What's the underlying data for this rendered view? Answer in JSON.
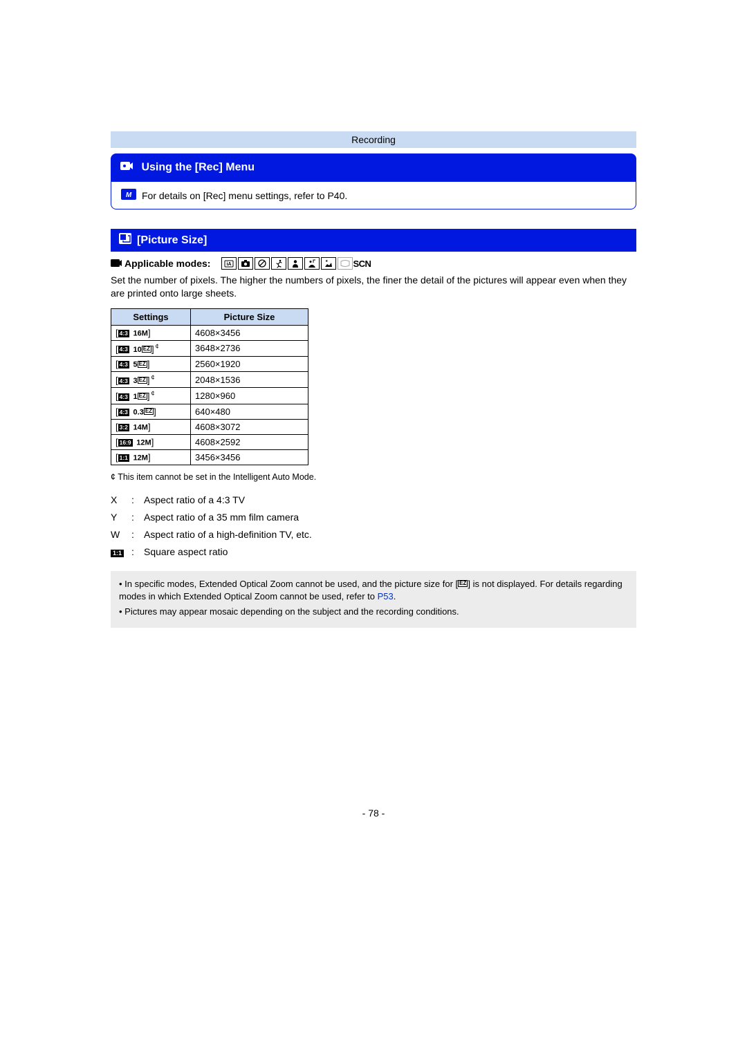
{
  "header": {
    "category": "Recording"
  },
  "main_title": {
    "icon": "rec-menu-icon",
    "text": "Using the [Rec] Menu"
  },
  "description": {
    "icon": "menu-set-icon",
    "text": "For details on [Rec] menu settings, refer to P40."
  },
  "section": {
    "title": "[Picture Size]",
    "icon": "picture-size-icon"
  },
  "modes_label": {
    "icon": "applicable-modes-icon",
    "text": "Applicable modes:"
  },
  "mode_icons": [
    {
      "name": "ia-mode-icon",
      "type": "svg-ia",
      "dim": false
    },
    {
      "name": "camera-mode-icon",
      "type": "svg-camera",
      "dim": false
    },
    {
      "name": "creative-mode-icon",
      "type": "svg-circle-slash",
      "dim": false
    },
    {
      "name": "sports-mode-icon",
      "type": "svg-runner",
      "dim": false
    },
    {
      "name": "portrait-mode-icon",
      "type": "svg-person",
      "dim": false
    },
    {
      "name": "scenery-mode-icon",
      "type": "svg-scene1",
      "dim": false
    },
    {
      "name": "night-mode-icon",
      "type": "svg-night",
      "dim": false
    },
    {
      "name": "panorama-mode-icon",
      "type": "svg-panorama",
      "dim": true
    },
    {
      "name": "scn-mode-icon",
      "type": "text-scn",
      "label": "SCN",
      "dim": false
    }
  ],
  "body_text": "Set the number of pixels. The higher the numbers of pixels, the finer the detail of the pictures will appear even when they are printed onto large sheets.",
  "table": {
    "headers": {
      "a": "Settings",
      "b": "Picture Size"
    },
    "rows": [
      {
        "ratio": "4:3",
        "size": "16",
        "unit": "M",
        "ez": false,
        "star": false,
        "value": "4608×3456"
      },
      {
        "ratio": "4:3",
        "size": "10",
        "unit": "M",
        "ez": true,
        "star": true,
        "value": "3648×2736"
      },
      {
        "ratio": "4:3",
        "size": "5",
        "unit": "M",
        "ez": true,
        "star": false,
        "value": "2560×1920"
      },
      {
        "ratio": "4:3",
        "size": "3",
        "unit": "M",
        "ez": true,
        "star": true,
        "value": "2048×1536"
      },
      {
        "ratio": "4:3",
        "size": "1",
        "unit": "M",
        "ez": true,
        "star": true,
        "value": "1280×960"
      },
      {
        "ratio": "4:3",
        "size": "0.3",
        "unit": "M",
        "ez": true,
        "star": false,
        "value": "640×480"
      },
      {
        "ratio": "3:2",
        "size": "14",
        "unit": "M",
        "ez": false,
        "star": false,
        "value": "4608×3072"
      },
      {
        "ratio": "16:9",
        "size": "12",
        "unit": "M",
        "ez": false,
        "star": false,
        "value": "4608×2592"
      },
      {
        "ratio": "1:1",
        "size": "12",
        "unit": "M",
        "ez": false,
        "star": false,
        "value": "3456×3456"
      }
    ]
  },
  "star_note": "¢ This item cannot be set in the Intelligent Auto Mode.",
  "aspect_list": [
    {
      "sym": "X",
      "desc": "Aspect ratio of a 4:3 TV"
    },
    {
      "sym": "Y",
      "desc": "Aspect ratio of a 35 mm film camera"
    },
    {
      "sym": "W",
      "desc": "Aspect ratio of a high-definition TV, etc."
    },
    {
      "sym": "1:1",
      "desc": "Square aspect ratio",
      "icon": true
    }
  ],
  "notes": {
    "n1a": "In specific modes, Extended Optical Zoom cannot be used, and the picture size for [",
    "n1b": "] is not displayed. For details regarding modes in which Extended Optical Zoom cannot be used, refer to ",
    "n1link": "P53",
    "n1c": ".",
    "n2": "Pictures may appear mosaic depending on the subject and the recording conditions."
  },
  "page_number": "- 78 -"
}
